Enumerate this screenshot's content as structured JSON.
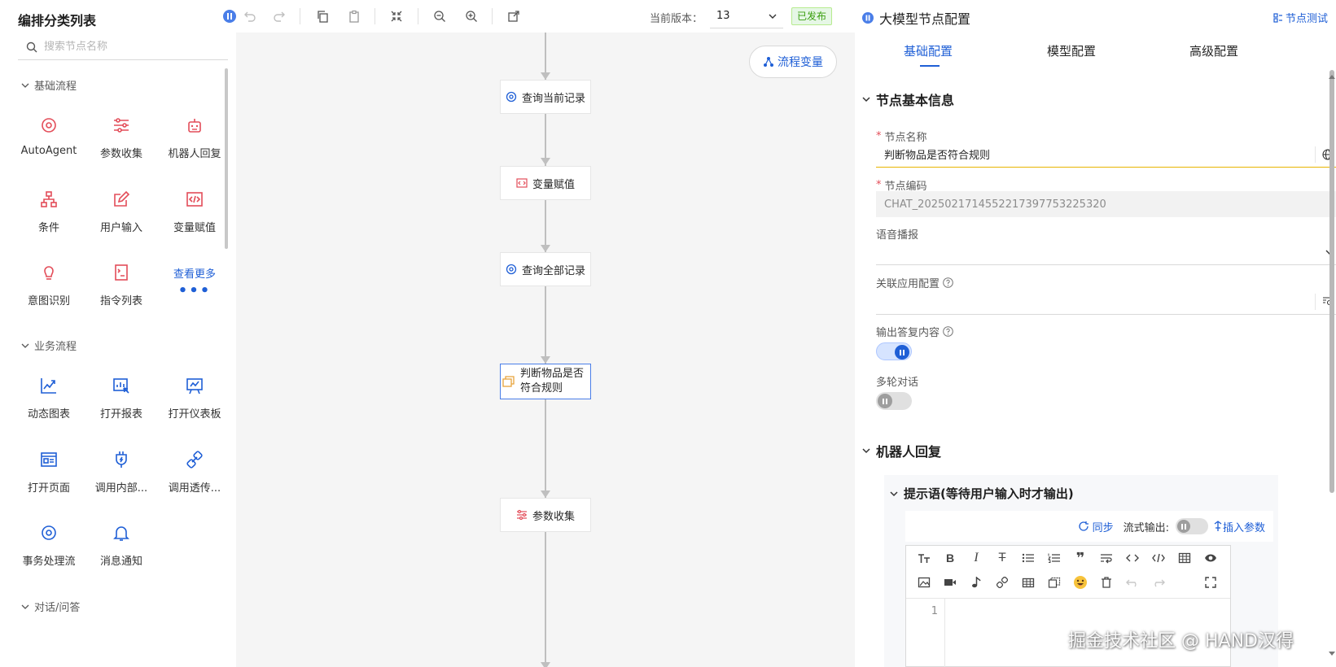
{
  "sidebar": {
    "title": "编排分类列表",
    "search_placeholder": "搜索节点名称",
    "groups": [
      {
        "name": "基础流程",
        "items": [
          "AutoAgent",
          "参数收集",
          "机器人回复",
          "条件",
          "用户输入",
          "变量赋值",
          "意图识别",
          "指令列表"
        ],
        "more": "查看更多",
        "more_dots": "•••"
      },
      {
        "name": "业务流程",
        "items": [
          "动态图表",
          "打开报表",
          "打开仪表板",
          "打开页面",
          "调用内部...",
          "调用透传...",
          "事务处理流",
          "消息通知"
        ]
      },
      {
        "name": "对话/问答"
      }
    ]
  },
  "toolbar": {
    "version_label": "当前版本：",
    "version_value": "13",
    "status": "已发布"
  },
  "canvas": {
    "var_button": "流程变量",
    "nodes": [
      "查询当前记录",
      "变量赋值",
      "查询全部记录",
      "判断物品是否符合规则",
      "参数收集"
    ],
    "active_node_lines": [
      "判断物品是否",
      "符合规则"
    ]
  },
  "panel": {
    "title": "大模型节点配置",
    "test_button": "节点测试",
    "tabs": [
      "基础配置",
      "模型配置",
      "高级配置"
    ],
    "section_basic": "节点基本信息",
    "name_label": "节点名称",
    "name_value": "判断物品是否符合规则",
    "code_label": "节点编码",
    "code_value": "CHAT_2025021714552217397753225320",
    "voice_label": "语音播报",
    "app_label": "关联应用配置",
    "output_label": "输出答复内容",
    "output_on": true,
    "multi_label": "多轮对话",
    "multi_on": false,
    "section_robot": "机器人回复",
    "prompt_title": "提示语(等待用户输入时才输出)",
    "sync_label": "同步",
    "stream_label": "流式输出:",
    "insert_label": "插入参数",
    "line_number": "1"
  },
  "watermark": "掘金技术社区 @ HAND汉得",
  "colors": {
    "accent": "#1f5fd6",
    "node_red": "#e34d59",
    "published": "#389e0d"
  }
}
